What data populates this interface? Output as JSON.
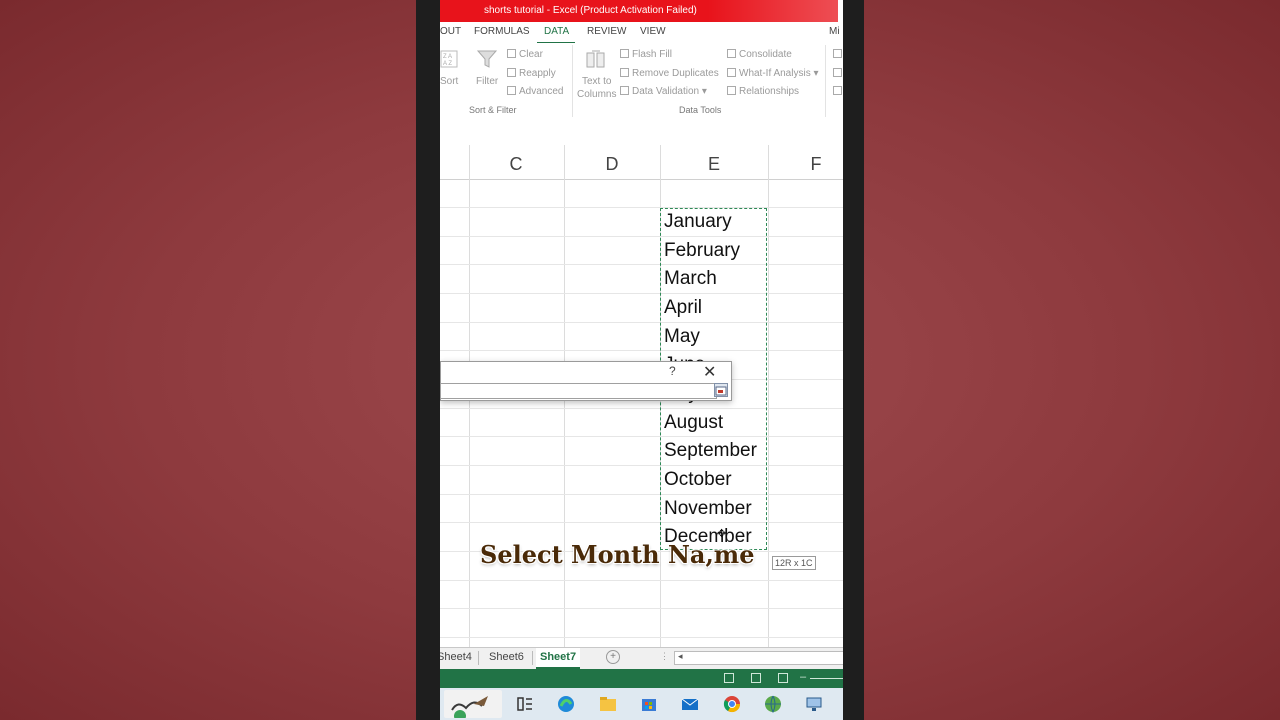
{
  "window": {
    "title": "shorts tutorial -  Excel (Product Activation Failed)"
  },
  "ribbon_tabs": [
    {
      "label": "OUT"
    },
    {
      "label": "FORMULAS"
    },
    {
      "label": "DATA"
    },
    {
      "label": "REVIEW"
    },
    {
      "label": "VIEW"
    },
    {
      "label": "Mi"
    }
  ],
  "active_tab": "DATA",
  "ribbon": {
    "sort": "Sort",
    "filter": "Filter",
    "clear": "Clear",
    "reapply": "Reapply",
    "advanced": "Advanced",
    "sort_filter_group": "Sort & Filter",
    "text_to_columns_1": "Text to",
    "text_to_columns_2": "Columns",
    "flash_fill": "Flash Fill",
    "remove_duplicates": "Remove Duplicates",
    "data_validation": "Data Validation",
    "consolidate": "Consolidate",
    "what_if": "What-If Analysis",
    "relationships": "Relationships",
    "data_tools_group": "Data Tools"
  },
  "columns": [
    "C",
    "D",
    "E",
    "F"
  ],
  "cells": [
    "January",
    "February",
    "March",
    "April",
    "May",
    "June",
    "July",
    "August",
    "September",
    "October",
    "November",
    "December"
  ],
  "dialog": {
    "help": "?",
    "close": "✕"
  },
  "overlay_caption": "Select Month Na,me",
  "selection_size_tip": "12R x 1C",
  "sheet_tabs": [
    "Sheet4",
    "Sheet6",
    "Sheet7"
  ],
  "active_sheet": "Sheet7",
  "colors": {
    "excel_green": "#217346",
    "title_red": "#e8131b",
    "marquee": "#2f8a57"
  }
}
